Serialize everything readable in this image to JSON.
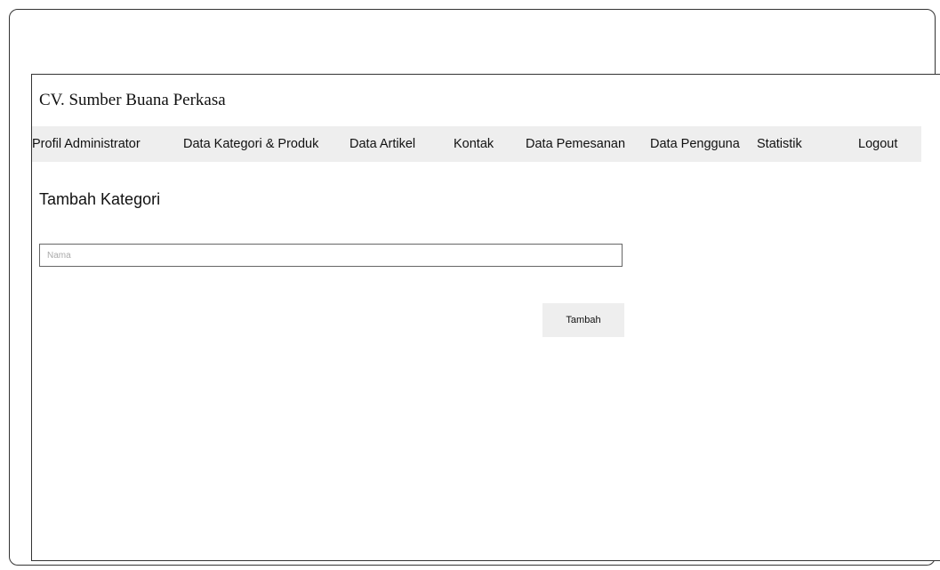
{
  "header": {
    "title": "CV. Sumber Buana Perkasa"
  },
  "nav": {
    "items": [
      {
        "label": "Profil Administrator"
      },
      {
        "label": "Data Kategori & Produk"
      },
      {
        "label": "Data Artikel"
      },
      {
        "label": "Kontak"
      },
      {
        "label": "Data Pemesanan"
      },
      {
        "label": "Data Pengguna"
      },
      {
        "label": "Statistik"
      },
      {
        "label": "Logout"
      }
    ]
  },
  "form": {
    "title": "Tambah Kategori",
    "name_placeholder": "Nama",
    "name_value": "",
    "submit_label": "Tambah"
  }
}
